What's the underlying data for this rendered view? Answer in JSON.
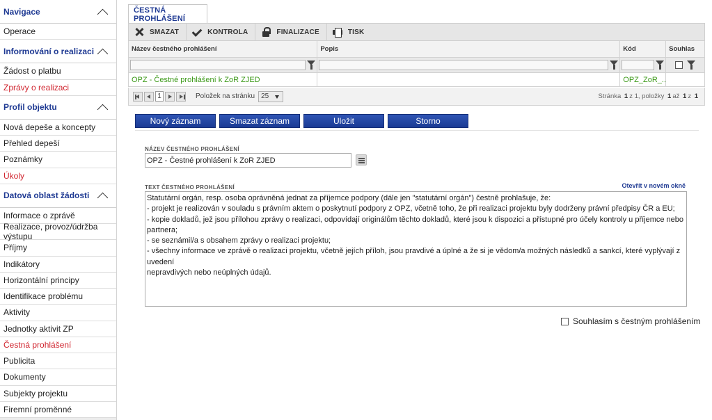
{
  "sidebar": {
    "rows": [
      {
        "label": "Navigace",
        "kind": "section"
      },
      {
        "label": "Operace",
        "kind": "item"
      },
      {
        "label": "Informování o realizaci",
        "kind": "section"
      },
      {
        "label": "Žádost o platbu",
        "kind": "item"
      },
      {
        "label": "Zprávy o realizaci",
        "kind": "item",
        "state": "active"
      },
      {
        "label": "Profil objektu",
        "kind": "section"
      },
      {
        "label": "Nová depeše a koncepty",
        "kind": "item"
      },
      {
        "label": "Přehled depeší",
        "kind": "item"
      },
      {
        "label": "Poznámky",
        "kind": "item"
      },
      {
        "label": "Úkoly",
        "kind": "item",
        "state": "active"
      },
      {
        "label": "Datová oblast žádosti",
        "kind": "section"
      },
      {
        "label": "Informace o zprávě",
        "kind": "item"
      },
      {
        "label": "Realizace, provoz/údržba výstupu",
        "kind": "item"
      },
      {
        "label": "Příjmy",
        "kind": "item"
      },
      {
        "label": "Indikátory",
        "kind": "item"
      },
      {
        "label": "Horizontální principy",
        "kind": "item"
      },
      {
        "label": "Identifikace problému",
        "kind": "item"
      },
      {
        "label": "Aktivity",
        "kind": "item"
      },
      {
        "label": "Jednotky aktivit ZP",
        "kind": "item"
      },
      {
        "label": "Čestná prohlášení",
        "kind": "item",
        "state": "active"
      },
      {
        "label": "Publicita",
        "kind": "item"
      },
      {
        "label": "Dokumenty",
        "kind": "item"
      },
      {
        "label": "Subjekty projektu",
        "kind": "item"
      },
      {
        "label": "Firemní proměnné",
        "kind": "item"
      },
      {
        "label": "Podpis dokumentu",
        "kind": "item",
        "state": "disabled"
      }
    ]
  },
  "tab": {
    "label": "ČESTNÁ PROHLÁŠENÍ"
  },
  "toolbar": {
    "delete": "SMAZAT",
    "check": "KONTROLA",
    "finalize": "FINALIZACE",
    "print": "TISK"
  },
  "grid": {
    "columns": [
      "Název čestného prohlášení",
      "Popis",
      "Kód",
      "Souhlas"
    ],
    "rows": [
      {
        "name": "OPZ - Čestné prohlášení k ZoR ZJED",
        "description": "",
        "code": "OPZ_ZoR_...",
        "agree": ""
      }
    ]
  },
  "pager": {
    "current_page": "1",
    "page_size_label": "Položek na stránku",
    "page_size": "25",
    "info_prefix": "Stránka",
    "page": "1",
    "info_of": "z",
    "page_total": "1",
    "info_items": ", položky",
    "from": "1",
    "info_to": "až",
    "to": "1",
    "info_of2": "z",
    "total": "1"
  },
  "form": {
    "buttons": {
      "new": "Nový záznam",
      "delete": "Smazat záznam",
      "save": "Uložit",
      "cancel": "Storno"
    },
    "name_label": "NÁZEV ČESTNÉHO PROHLÁŠENÍ",
    "name_value": "OPZ - Čestné prohlášení k ZoR ZJED",
    "text_label": "TEXT ČESTNÉHO PROHLÁŠENÍ",
    "open_new_window": "Otevřít v novém okně",
    "text_lines": [
      "Statutární orgán, resp. osoba oprávněná jednat za příjemce podpory (dále jen \"statutární orgán\") čestně prohlašuje, že:",
      "- projekt je realizován v souladu s právním aktem o poskytnutí podpory z OPZ, včetně toho, že při realizaci projektu byly dodrženy právní předpisy ČR a EU;",
      "- kopie dokladů, jež jsou přílohou zprávy o realizaci, odpovídají originálům těchto dokladů, které jsou k dispozici a přístupné pro účely kontroly u příjemce nebo partnera;",
      "- se seznámil/a s obsahem zprávy o realizaci projektu;",
      "- všechny informace ve zprávě o realizaci projektu, včetně jejích příloh, jsou pravdivé a úplné a že si je vědom/a možných následků a sankcí, které vyplývají z uvedení",
      "nepravdivých nebo neúplných údajů."
    ],
    "agree_label": "Souhlasím s čestným prohlášením",
    "agree_checked": false
  }
}
